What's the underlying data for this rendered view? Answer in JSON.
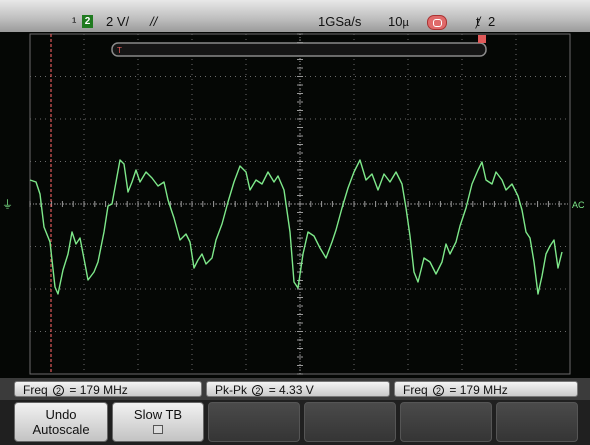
{
  "status_bar": {
    "channel_number": "2",
    "volts_per_div": "2 V/",
    "sample_rate": "1GSa/s",
    "timebase": "10",
    "trigger_channel": "2"
  },
  "screen": {
    "trace_color": "#7ee88a",
    "grid_color": "#6a6a6a",
    "cursor_color": "#e05a5a",
    "coupling_label": "AC"
  },
  "measurements": [
    {
      "label": "Freq",
      "channel": "2",
      "value": "= 179 MHz"
    },
    {
      "label": "Pk-Pk",
      "channel": "2",
      "value": "= 4.33 V"
    },
    {
      "label": "Freq",
      "channel": "2",
      "value": "= 179 MHz"
    }
  ],
  "softkeys": {
    "undo_line1": "Undo",
    "undo_line2": "Autoscale",
    "slow_tb": "Slow TB"
  }
}
